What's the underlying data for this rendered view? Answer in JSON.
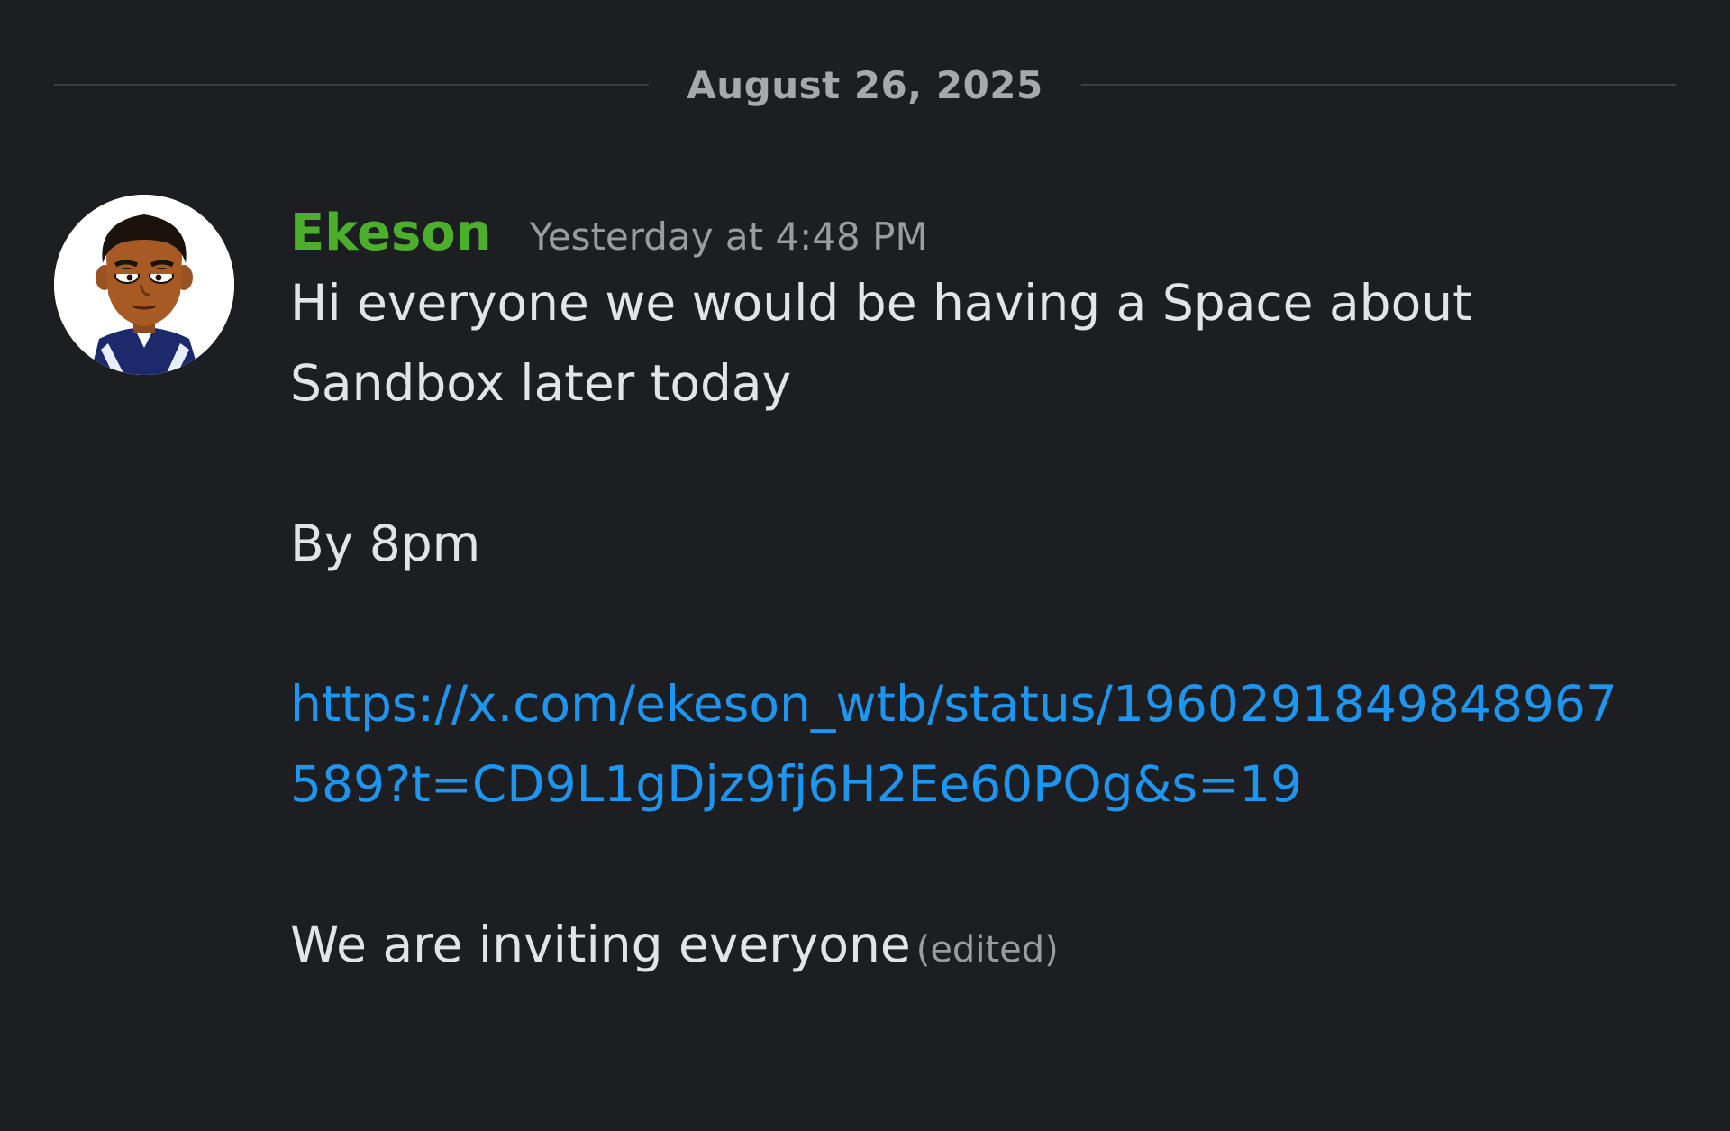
{
  "divider": {
    "date": "August 26, 2025"
  },
  "message": {
    "author": "Ekeson",
    "author_color": "#4caf2c",
    "timestamp": "Yesterday at 4:48 PM",
    "line1": "Hi everyone we would be having a Space about Sandbox later today",
    "line2": "By 8pm",
    "link": "https://x.com/ekeson_wtb/status/1960291849848967589?t=CD9L1gDjz9fj6H2Ee60POg&s=19",
    "line3": "We are inviting everyone",
    "edited_label": "(edited)"
  },
  "avatar": {
    "icon": "cartoon-avatar-icon"
  },
  "colors": {
    "background": "#1d1e22",
    "link": "#1e96f0",
    "text": "#e3e4e8",
    "muted": "#9a9ca2"
  }
}
